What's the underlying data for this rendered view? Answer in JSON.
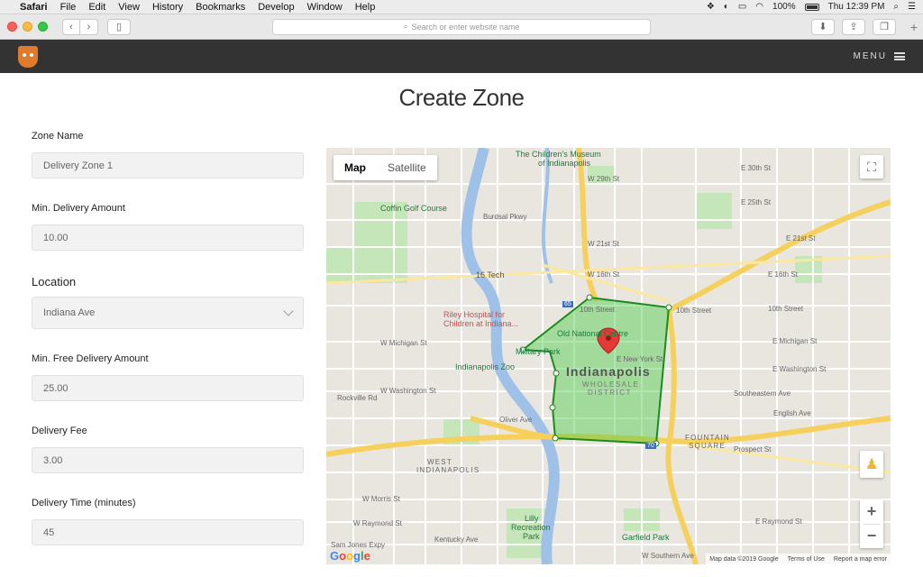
{
  "mac_menu": {
    "app": "Safari",
    "items": [
      "File",
      "Edit",
      "View",
      "History",
      "Bookmarks",
      "Develop",
      "Window",
      "Help"
    ],
    "battery": "100%",
    "clock": "Thu 12:39 PM"
  },
  "browser": {
    "url_placeholder": "Search or enter website name"
  },
  "header": {
    "menu_label": "MENU"
  },
  "page": {
    "title": "Create Zone"
  },
  "form": {
    "zone_name": {
      "label": "Zone Name",
      "value": "Delivery Zone 1"
    },
    "min_delivery": {
      "label": "Min. Delivery Amount",
      "value": "10.00"
    },
    "location": {
      "label": "Location",
      "value": "Indiana Ave"
    },
    "min_free_delivery": {
      "label": "Min. Free Delivery Amount",
      "value": "25.00"
    },
    "delivery_fee": {
      "label": "Delivery Fee",
      "value": "3.00"
    },
    "delivery_time": {
      "label": "Delivery Time (minutes)",
      "value": "45"
    }
  },
  "map": {
    "type_map": "Map",
    "type_satellite": "Satellite",
    "zoom_in": "+",
    "zoom_out": "−",
    "attribution": "Map data ©2019 Google",
    "terms": "Terms of Use",
    "report": "Report a map error",
    "google": [
      "G",
      "o",
      "o",
      "g",
      "l",
      "e"
    ],
    "labels": {
      "childrens_museum": "The Children's Museum",
      "childrens_museum_2": "of Indianapolis",
      "coffin_golf": "Coffin Golf Course",
      "tech16": "16 Tech",
      "riley_hospital": "Riley Hospital for",
      "riley_hospital_2": "Children at Indiana...",
      "old_national": "Old National Centre",
      "military_park": "Military Park",
      "indianapolis_zoo": "Indianapolis Zoo",
      "indianapolis": "Indianapolis",
      "wholesale": "WHOLESALE",
      "district": "DISTRICT",
      "fountain": "FOUNTAIN",
      "square": "SQUARE",
      "west": "WEST",
      "west_indy": "INDIANAPOLIS",
      "lilly": "Lilly",
      "recreation": "Recreation",
      "park": "Park",
      "garfield": "Garfield Park",
      "e30": "E 30th St",
      "w29": "W 29th St",
      "e25": "E 25th St",
      "w21": "W 21st St",
      "e21": "E 21st St",
      "w16": "W 16th St",
      "e16": "E 16th St",
      "tenth": "10th Street",
      "tenth_b": "10th Street",
      "tenth_c": "10th Street",
      "michigan": "W Michigan St",
      "e_michigan": "E Michigan St",
      "new_york": "E New York St",
      "washington": "W Washington St",
      "e_washington": "E Washington St",
      "rockville": "Rockville Rd",
      "oliver": "Oliver Ave",
      "english": "English Ave",
      "prospect": "Prospect St",
      "raymond": "E Raymond St",
      "raymond_w": "W Raymond St",
      "southeastern": "Southeastern Ave",
      "burdsal": "Burdsal Pkwy",
      "morris": "W Morris St",
      "kentucky": "Kentucky Ave",
      "sam_jones": "Sam Jones Expy",
      "southern": "W Southern Ave",
      "i65": "65",
      "i70": "70"
    }
  }
}
